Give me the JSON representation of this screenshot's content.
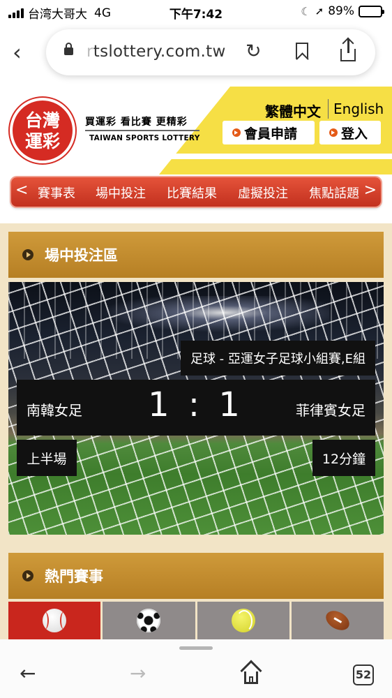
{
  "status_bar": {
    "carrier": "台湾大哥大",
    "network": "4G",
    "time": "下午7:42",
    "battery": "89%",
    "battery_level": 0.89
  },
  "browser": {
    "url_faded": "r",
    "url_text": "tslottery.com.tw",
    "tab_count": "52"
  },
  "site_header": {
    "logo_line1": "台灣",
    "logo_line2": "運彩",
    "slogan": "買運彩 看比賽 更精彩",
    "slogan_en": "TAIWAN SPORTS LOTTERY",
    "lang_zh": "繁體中文",
    "lang_en": "English",
    "member_button": "會員申請",
    "login_button": "登入"
  },
  "nav": {
    "left_arrow": "<",
    "right_arrow": ">",
    "items": [
      "賽事表",
      "場中投注",
      "比賽結果",
      "虛擬投注",
      "焦點話題"
    ]
  },
  "live_section": {
    "title": "場中投注區",
    "league": "足球 - 亞運女子足球小組賽,E組",
    "home_team": "南韓女足",
    "away_team": "菲律賓女足",
    "score": "1 : 1",
    "period": "上半場",
    "minute": "12分鐘"
  },
  "hot_section": {
    "title": "熱門賽事",
    "sport_tabs": [
      {
        "icon": "baseball-icon",
        "active": true
      },
      {
        "icon": "soccer-ball-icon",
        "active": false
      },
      {
        "icon": "tennis-ball-icon",
        "active": false
      },
      {
        "icon": "american-football-icon",
        "active": false
      }
    ]
  },
  "colors": {
    "nav_red": "#d7412b",
    "section_gold": "#c48b2e",
    "header_yellow": "#f6df45",
    "content_beige": "#f2e4c6"
  }
}
